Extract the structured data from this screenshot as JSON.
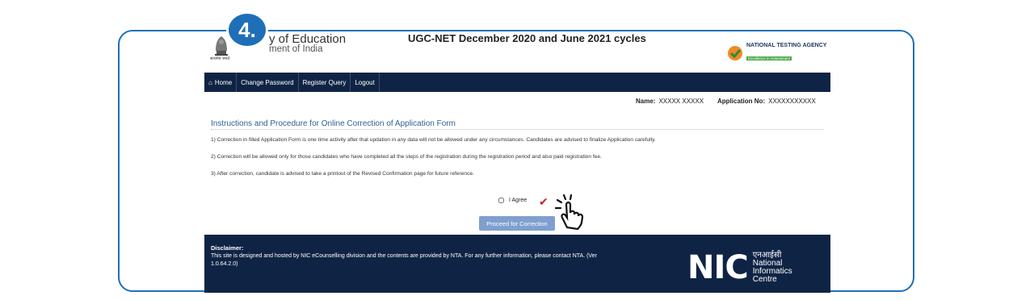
{
  "step": {
    "number": "4."
  },
  "header": {
    "emblem_caption": "सत्यमेव जयते",
    "ministry_title": "y of Education",
    "ministry_sub": "ment of India",
    "page_title": "UGC-NET December 2020 and June 2021 cycles",
    "nta_name": "NATIONAL TESTING AGENCY",
    "nta_tagline": "Excellence in Assessment"
  },
  "nav": {
    "home": "Home",
    "change_password": "Change Password",
    "register_query": "Register Query",
    "logout": "Logout"
  },
  "user": {
    "name_label": "Name:",
    "name_value": "XXXXX XXXXX",
    "appno_label": "Application No:",
    "appno_value": "XXXXXXXXXXX"
  },
  "instructions": {
    "title": "Instructions and Procedure for Online Correction of Application Form",
    "items": [
      "1) Correction in filled Application Form is one time activity after that updation in any data will not be allowed under any circumstances. Candidates are advised to finalize Application carefully.",
      "2) Correction will be allowed only for those candidates who have completed all the steps of the registration during the registration period and also paid registration fee.",
      "3) After correction, candidate is advised to take a printout of the Revised Confirmation page for future reference."
    ]
  },
  "agree": {
    "label": "I Agree"
  },
  "proceed_button": "Proceed for Correction",
  "footer": {
    "disclaimer_title": "Disclaimer:",
    "disclaimer_text": "This site is designed and hosted by NIC eCounselling division and the contents are provided by NTA. For any further information, please contact NTA. (Ver 1.0.64.2.0)",
    "nic_logo": "NIC",
    "nic_hindi": "एनआईसी",
    "nic_line1": "National",
    "nic_line2": "Informatics",
    "nic_line3": "Centre"
  },
  "colors": {
    "accent": "#1e6fb8",
    "navbar": "#0f2445",
    "title_blue": "#2e5e99",
    "button": "#7f9fcf",
    "check": "#c0292b"
  }
}
